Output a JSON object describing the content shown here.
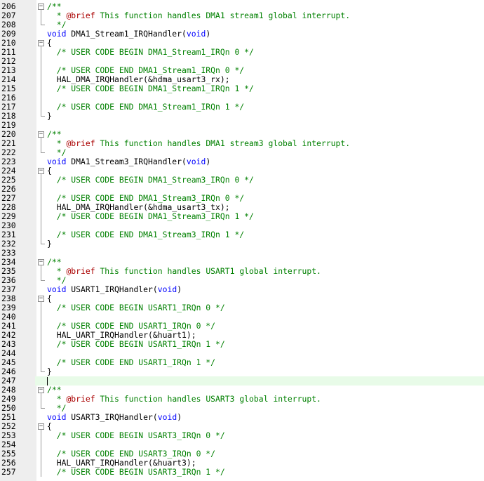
{
  "editor": {
    "current_line": 247,
    "lines": [
      {
        "n": "206",
        "fold": "open",
        "tokens": [
          {
            "t": "comment",
            "v": "/**"
          }
        ]
      },
      {
        "n": "207",
        "fold": "line",
        "tokens": [
          {
            "t": "comment",
            "v": "  * "
          },
          {
            "t": "doc",
            "v": "@brief"
          },
          {
            "t": "comment",
            "v": " This function handles DMA1 stream1 global interrupt."
          }
        ]
      },
      {
        "n": "208",
        "fold": "end",
        "tokens": [
          {
            "t": "comment",
            "v": "  */"
          }
        ]
      },
      {
        "n": "209",
        "fold": "",
        "tokens": [
          {
            "t": "keyword",
            "v": "void"
          },
          {
            "t": "plain",
            "v": " DMA1_Stream1_IRQHandler("
          },
          {
            "t": "keyword",
            "v": "void"
          },
          {
            "t": "plain",
            "v": ")"
          }
        ]
      },
      {
        "n": "210",
        "fold": "open",
        "tokens": [
          {
            "t": "plain",
            "v": "{"
          }
        ]
      },
      {
        "n": "211",
        "fold": "line",
        "tokens": [
          {
            "t": "comment",
            "v": "  /* USER CODE BEGIN DMA1_Stream1_IRQn 0 */"
          }
        ]
      },
      {
        "n": "212",
        "fold": "line",
        "tokens": []
      },
      {
        "n": "213",
        "fold": "line",
        "tokens": [
          {
            "t": "comment",
            "v": "  /* USER CODE END DMA1_Stream1_IRQn 0 */"
          }
        ]
      },
      {
        "n": "214",
        "fold": "line",
        "tokens": [
          {
            "t": "plain",
            "v": "  HAL_DMA_IRQHandler(&hdma_usart3_rx);"
          }
        ]
      },
      {
        "n": "215",
        "fold": "line",
        "tokens": [
          {
            "t": "comment",
            "v": "  /* USER CODE BEGIN DMA1_Stream1_IRQn 1 */"
          }
        ]
      },
      {
        "n": "216",
        "fold": "line",
        "tokens": []
      },
      {
        "n": "217",
        "fold": "line",
        "tokens": [
          {
            "t": "comment",
            "v": "  /* USER CODE END DMA1_Stream1_IRQn 1 */"
          }
        ]
      },
      {
        "n": "218",
        "fold": "end",
        "tokens": [
          {
            "t": "plain",
            "v": "}"
          }
        ]
      },
      {
        "n": "219",
        "fold": "",
        "tokens": []
      },
      {
        "n": "220",
        "fold": "open",
        "tokens": [
          {
            "t": "comment",
            "v": "/**"
          }
        ]
      },
      {
        "n": "221",
        "fold": "line",
        "tokens": [
          {
            "t": "comment",
            "v": "  * "
          },
          {
            "t": "doc",
            "v": "@brief"
          },
          {
            "t": "comment",
            "v": " This function handles DMA1 stream3 global interrupt."
          }
        ]
      },
      {
        "n": "222",
        "fold": "end",
        "tokens": [
          {
            "t": "comment",
            "v": "  */"
          }
        ]
      },
      {
        "n": "223",
        "fold": "",
        "tokens": [
          {
            "t": "keyword",
            "v": "void"
          },
          {
            "t": "plain",
            "v": " DMA1_Stream3_IRQHandler("
          },
          {
            "t": "keyword",
            "v": "void"
          },
          {
            "t": "plain",
            "v": ")"
          }
        ]
      },
      {
        "n": "224",
        "fold": "open",
        "tokens": [
          {
            "t": "plain",
            "v": "{"
          }
        ]
      },
      {
        "n": "225",
        "fold": "line",
        "tokens": [
          {
            "t": "comment",
            "v": "  /* USER CODE BEGIN DMA1_Stream3_IRQn 0 */"
          }
        ]
      },
      {
        "n": "226",
        "fold": "line",
        "tokens": []
      },
      {
        "n": "227",
        "fold": "line",
        "tokens": [
          {
            "t": "comment",
            "v": "  /* USER CODE END DMA1_Stream3_IRQn 0 */"
          }
        ]
      },
      {
        "n": "228",
        "fold": "line",
        "tokens": [
          {
            "t": "plain",
            "v": "  HAL_DMA_IRQHandler(&hdma_usart3_tx);"
          }
        ]
      },
      {
        "n": "229",
        "fold": "line",
        "tokens": [
          {
            "t": "comment",
            "v": "  /* USER CODE BEGIN DMA1_Stream3_IRQn 1 */"
          }
        ]
      },
      {
        "n": "230",
        "fold": "line",
        "tokens": []
      },
      {
        "n": "231",
        "fold": "line",
        "tokens": [
          {
            "t": "comment",
            "v": "  /* USER CODE END DMA1_Stream3_IRQn 1 */"
          }
        ]
      },
      {
        "n": "232",
        "fold": "end",
        "tokens": [
          {
            "t": "plain",
            "v": "}"
          }
        ]
      },
      {
        "n": "233",
        "fold": "",
        "tokens": []
      },
      {
        "n": "234",
        "fold": "open",
        "tokens": [
          {
            "t": "comment",
            "v": "/**"
          }
        ]
      },
      {
        "n": "235",
        "fold": "line",
        "tokens": [
          {
            "t": "comment",
            "v": "  * "
          },
          {
            "t": "doc",
            "v": "@brief"
          },
          {
            "t": "comment",
            "v": " This function handles USART1 global interrupt."
          }
        ]
      },
      {
        "n": "236",
        "fold": "end",
        "tokens": [
          {
            "t": "comment",
            "v": "  */"
          }
        ]
      },
      {
        "n": "237",
        "fold": "",
        "tokens": [
          {
            "t": "keyword",
            "v": "void"
          },
          {
            "t": "plain",
            "v": " USART1_IRQHandler("
          },
          {
            "t": "keyword",
            "v": "void"
          },
          {
            "t": "plain",
            "v": ")"
          }
        ]
      },
      {
        "n": "238",
        "fold": "open",
        "tokens": [
          {
            "t": "plain",
            "v": "{"
          }
        ]
      },
      {
        "n": "239",
        "fold": "line",
        "tokens": [
          {
            "t": "comment",
            "v": "  /* USER CODE BEGIN USART1_IRQn 0 */"
          }
        ]
      },
      {
        "n": "240",
        "fold": "line",
        "tokens": []
      },
      {
        "n": "241",
        "fold": "line",
        "tokens": [
          {
            "t": "comment",
            "v": "  /* USER CODE END USART1_IRQn 0 */"
          }
        ]
      },
      {
        "n": "242",
        "fold": "line",
        "tokens": [
          {
            "t": "plain",
            "v": "  HAL_UART_IRQHandler(&huart1);"
          }
        ]
      },
      {
        "n": "243",
        "fold": "line",
        "tokens": [
          {
            "t": "comment",
            "v": "  /* USER CODE BEGIN USART1_IRQn 1 */"
          }
        ]
      },
      {
        "n": "244",
        "fold": "line",
        "tokens": []
      },
      {
        "n": "245",
        "fold": "line",
        "tokens": [
          {
            "t": "comment",
            "v": "  /* USER CODE END USART1_IRQn 1 */"
          }
        ]
      },
      {
        "n": "246",
        "fold": "end",
        "tokens": [
          {
            "t": "plain",
            "v": "}"
          }
        ]
      },
      {
        "n": "247",
        "fold": "",
        "tokens": []
      },
      {
        "n": "248",
        "fold": "open",
        "tokens": [
          {
            "t": "comment",
            "v": "/**"
          }
        ]
      },
      {
        "n": "249",
        "fold": "line",
        "tokens": [
          {
            "t": "comment",
            "v": "  * "
          },
          {
            "t": "doc",
            "v": "@brief"
          },
          {
            "t": "comment",
            "v": " This function handles USART3 global interrupt."
          }
        ]
      },
      {
        "n": "250",
        "fold": "end",
        "tokens": [
          {
            "t": "comment",
            "v": "  */"
          }
        ]
      },
      {
        "n": "251",
        "fold": "",
        "tokens": [
          {
            "t": "keyword",
            "v": "void"
          },
          {
            "t": "plain",
            "v": " USART3_IRQHandler("
          },
          {
            "t": "keyword",
            "v": "void"
          },
          {
            "t": "plain",
            "v": ")"
          }
        ]
      },
      {
        "n": "252",
        "fold": "open",
        "tokens": [
          {
            "t": "plain",
            "v": "{"
          }
        ]
      },
      {
        "n": "253",
        "fold": "line",
        "tokens": [
          {
            "t": "comment",
            "v": "  /* USER CODE BEGIN USART3_IRQn 0 */"
          }
        ]
      },
      {
        "n": "254",
        "fold": "line",
        "tokens": []
      },
      {
        "n": "255",
        "fold": "line",
        "tokens": [
          {
            "t": "comment",
            "v": "  /* USER CODE END USART3_IRQn 0 */"
          }
        ]
      },
      {
        "n": "256",
        "fold": "line",
        "tokens": [
          {
            "t": "plain",
            "v": "  HAL_UART_IRQHandler(&huart3);"
          }
        ]
      },
      {
        "n": "257",
        "fold": "line",
        "tokens": [
          {
            "t": "comment",
            "v": "  /* USER CODE BEGIN USART3_IRQn 1 */"
          }
        ]
      }
    ]
  },
  "colors": {
    "comment": "#008000",
    "keyword": "#0000ff",
    "doc_tag": "#aa0000",
    "current_line_bg": "#e8fbe8",
    "gutter_bg": "#eeeeee"
  }
}
